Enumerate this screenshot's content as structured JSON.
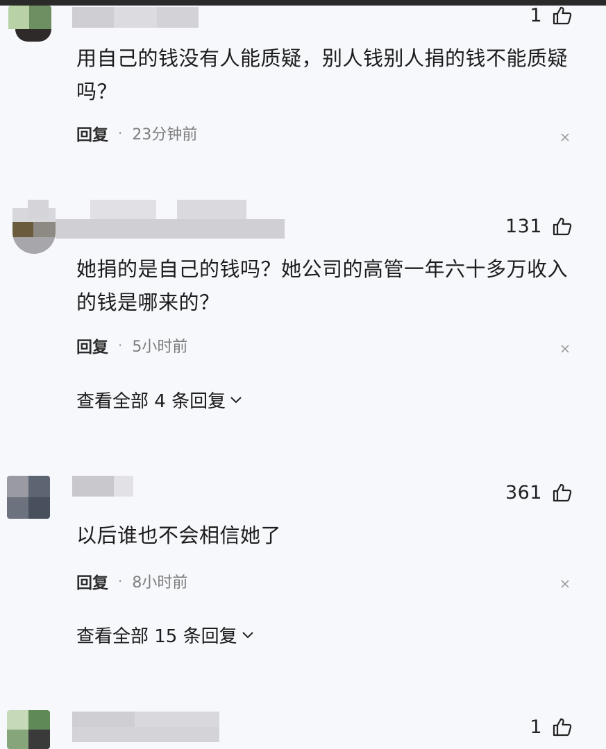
{
  "comments": [
    {
      "likes": "1",
      "text": "用自己的钱没有人能质疑，别人钱别人捐的钱不能质疑吗？",
      "reply": "回复",
      "time": "23分钟前"
    },
    {
      "likes": "131",
      "text": "她捐的是自己的钱吗？她公司的高管一年六十多万收入的钱是哪来的？",
      "reply": "回复",
      "time": "5小时前",
      "view_replies": "查看全部 4 条回复"
    },
    {
      "likes": "361",
      "text": "以后谁也不会相信她了",
      "reply": "回复",
      "time": "8小时前",
      "view_replies": "查看全部 15 条回复"
    },
    {
      "likes": "1"
    }
  ],
  "icons": {
    "like": "thumbs-up-icon",
    "dismiss": "close-icon",
    "expand": "chevron-down-icon"
  },
  "colors": {
    "background": "#f7f8fc",
    "text": "#1c1c1c",
    "muted": "#7c7c7c"
  }
}
